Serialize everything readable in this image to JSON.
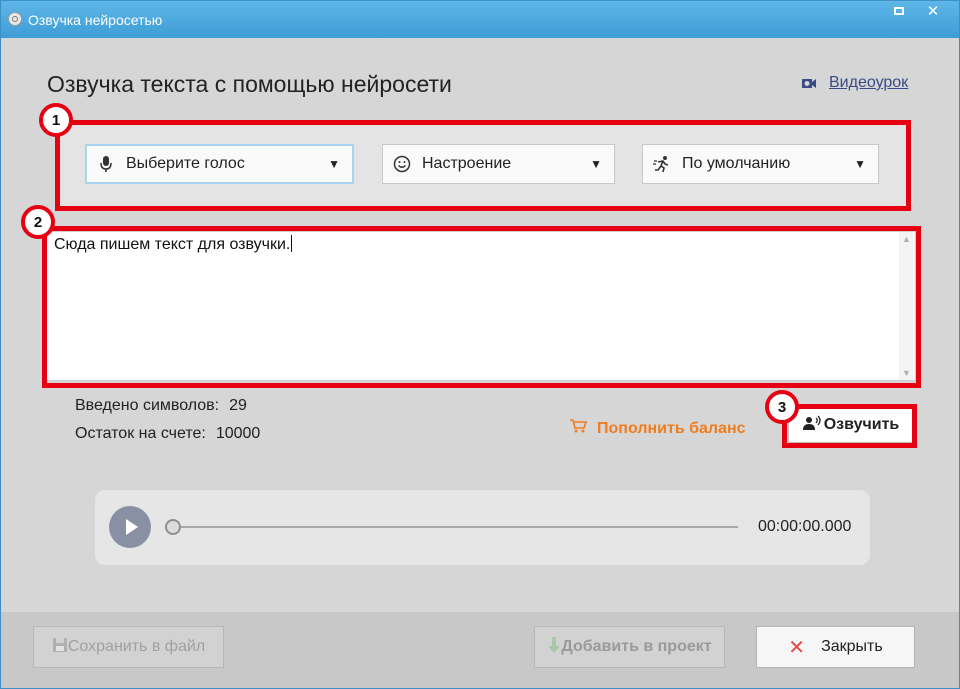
{
  "window": {
    "title": "Озвучка нейросетью"
  },
  "header": {
    "title": "Озвучка текста с помощью нейросети",
    "video_link": "Видеоурок"
  },
  "selects": {
    "voice": "Выберите голос",
    "mood": "Настроение",
    "preset": "По умолчанию"
  },
  "editor": {
    "text": "Сюда пишем текст для озвучки."
  },
  "stats": {
    "entered_label": "Введено символов:",
    "entered_value": "29",
    "balance_label": "Остаток на счете:",
    "balance_value": "10000"
  },
  "actions": {
    "top_up": "Пополнить баланс",
    "speak": "Озвучить"
  },
  "player": {
    "time": "00:00:00.000",
    "progress": 0
  },
  "footer": {
    "save": "Сохранить в файл",
    "add": "Добавить в проект",
    "close": "Закрыть"
  },
  "annotations": [
    "1",
    "2",
    "3"
  ],
  "colors": {
    "accent_orange": "#f07d1e",
    "annotation_red": "#e60012",
    "titlebar_blue": "#4aa3d8"
  }
}
